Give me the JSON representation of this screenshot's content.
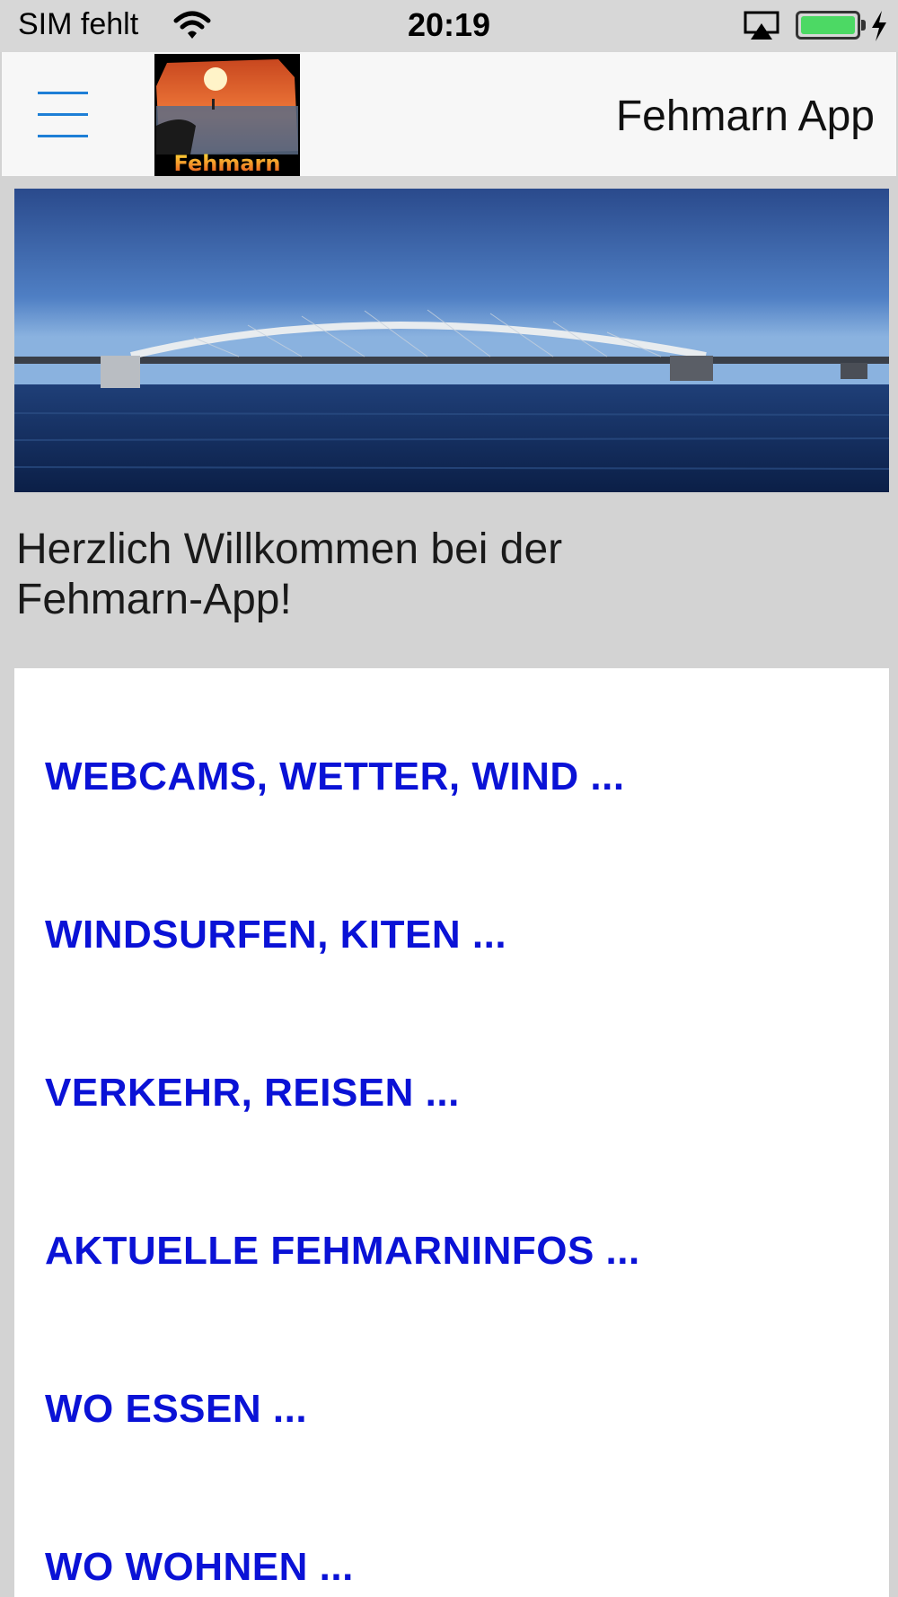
{
  "status_bar": {
    "carrier": "SIM fehlt",
    "time": "20:19",
    "icons": [
      "wifi-icon",
      "airplay-icon",
      "battery-icon",
      "charging-bolt-icon"
    ],
    "battery_color": "#4cd964"
  },
  "nav": {
    "title": "Fehmarn App",
    "logo_text": "Fehmarn",
    "menu_icon": "hamburger-menu-icon",
    "accent": "#1e7fd6"
  },
  "welcome": {
    "line1": "Herzlich Willkommen bei der",
    "line2": "Fehmarn-App!"
  },
  "menu": {
    "link_color": "#0a12d6",
    "items": [
      {
        "label": "WEBCAMS, WETTER, WIND ..."
      },
      {
        "label": "WINDSURFEN, KITEN ..."
      },
      {
        "label": "VERKEHR, REISEN ..."
      },
      {
        "label": "AKTUELLE FEHMARNINFOS ..."
      },
      {
        "label": "WO ESSEN ..."
      },
      {
        "label": "WO WOHNEN ..."
      }
    ]
  }
}
